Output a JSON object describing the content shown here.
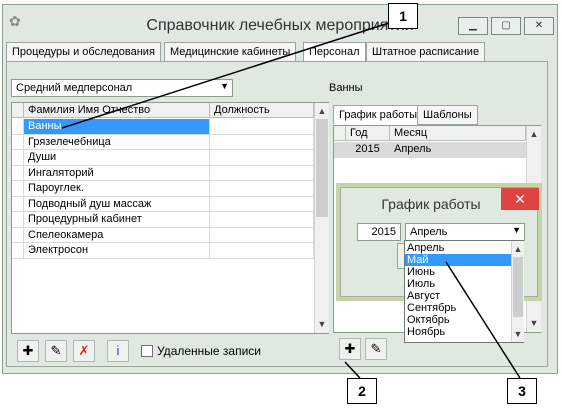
{
  "window": {
    "title": "Справочник лечебных мероприятий",
    "icons": {
      "app": "app-icon",
      "minimize": "minimize-icon",
      "maximize": "maximize-icon",
      "close": "close-icon"
    }
  },
  "tabs": [
    {
      "label": "Процедуры и обследования",
      "active": false
    },
    {
      "label": "Медицинские кабинеты",
      "active": false
    },
    {
      "label": "Персонал",
      "active": true
    },
    {
      "label": "Штатное расписание",
      "active": false
    }
  ],
  "category_select": {
    "value": "Средний медперсонал"
  },
  "selected_staff": "Ванны",
  "staff_grid": {
    "columns": [
      "Фамилия Имя Отчество",
      "Должность"
    ],
    "rows": [
      "Ванны",
      "Грязелечебница",
      "Души",
      "Ингаляторий",
      "Пароуглек.",
      "Подводный душ массаж",
      "Процедурный кабинет",
      "Спелеокамера",
      "Электросон"
    ],
    "selected_index": 0
  },
  "toolbar_left": {
    "buttons": [
      "add-icon",
      "edit-icon",
      "delete-icon",
      "info-icon"
    ],
    "deleted_records_label": "Удаленные записи"
  },
  "right_tabs": [
    {
      "label": "График работы",
      "active": true
    },
    {
      "label": "Шаблоны",
      "active": false
    }
  ],
  "schedule_grid": {
    "columns": [
      "Год",
      "Месяц"
    ],
    "rows": [
      {
        "year": "2015",
        "month": "Апрель"
      }
    ]
  },
  "dialog": {
    "title": "График работы",
    "year": "2015",
    "month": "Апрель",
    "months": [
      "Апрель",
      "Май",
      "Июнь",
      "Июль",
      "Август",
      "Сентябрь",
      "Октябрь",
      "Ноябрь"
    ],
    "highlighted_month": "Май"
  },
  "callouts": [
    "1",
    "2",
    "3"
  ]
}
